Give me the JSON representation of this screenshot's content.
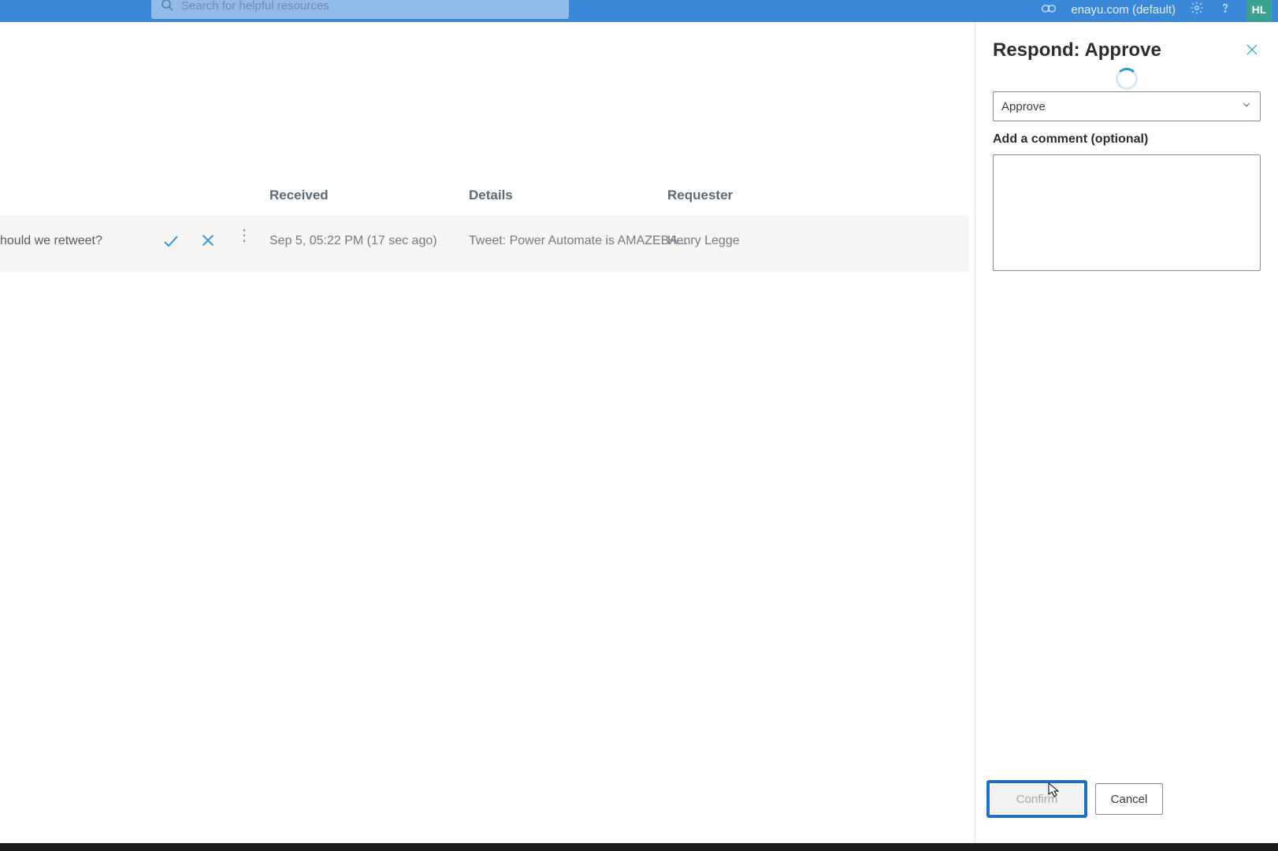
{
  "header": {
    "search_placeholder": "Search for helpful resources",
    "tenant": "enayu.com (default)",
    "user_initials": "HL"
  },
  "columns": {
    "received": "Received",
    "details": "Details",
    "requester": "Requester"
  },
  "row": {
    "title_fragment": "hould we retweet?",
    "received": "Sep 5, 05:22 PM (17 sec ago)",
    "details": "Tweet: Power Automate is AMAZEBA...",
    "requester": "Henry Legge"
  },
  "panel": {
    "title": "Respond: Approve",
    "decision_value": "Approve",
    "comment_label": "Add a comment (optional)",
    "confirm_label": "Confirm",
    "cancel_label": "Cancel"
  }
}
